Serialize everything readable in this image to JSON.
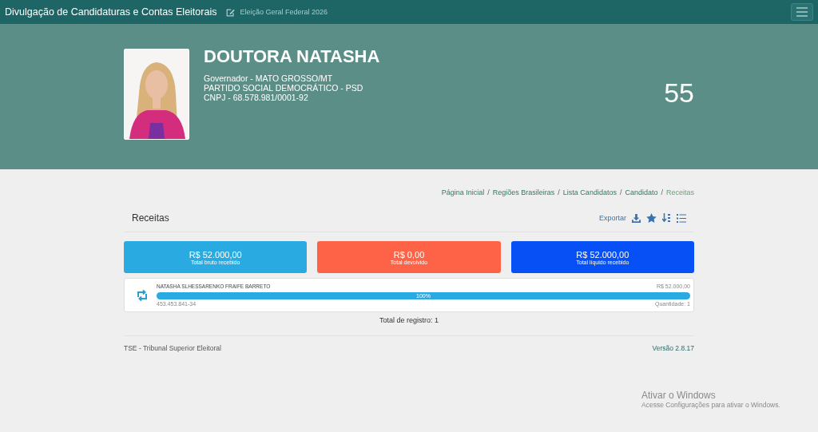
{
  "navbar": {
    "title": "Divulgação de Candidaturas e Contas Eleitorais",
    "election": "Eleição Geral Federal 2026"
  },
  "candidate": {
    "name": "DOUTORA NATASHA",
    "office": "Governador - MATO GROSSO/MT",
    "party": "PARTIDO SOCIAL DEMOCRÁTICO - PSD",
    "cnpj": "CNPJ - 68.578.981/0001-92",
    "number": "55"
  },
  "breadcrumb": {
    "separator": "/",
    "items": [
      "Página Inicial",
      "Regiões Brasileiras",
      "Lista Candidatos",
      "Candidato",
      "Receitas"
    ]
  },
  "section": {
    "title": "Receitas",
    "export": "Exportar"
  },
  "totals": [
    {
      "value": "R$ 52.000,00",
      "label": "Total bruto recebido",
      "color": "#29abe2"
    },
    {
      "value": "R$ 0,00",
      "label": "Total devolvido",
      "color": "#ff6347"
    },
    {
      "value": "R$ 52.000,00",
      "label": "Total líquido recebido",
      "color": "#0750f5"
    }
  ],
  "donors": [
    {
      "name": "NATASHA SLHESSARENKO FRAIFE BARRETO",
      "amount": "R$ 52.000,00",
      "level": 1,
      "percent": "100%",
      "document": "453.453.841-34",
      "quantity": "Quantidade: 1"
    }
  ],
  "total_records": "Total de registro: 1",
  "footer": {
    "left": "TSE - Tribunal Superior Eleitoral",
    "version": "Versão 2.8.17"
  },
  "os_notice": {
    "title": "Ativar o Windows",
    "text": "Acesse Configurações para ativar o Windows."
  }
}
